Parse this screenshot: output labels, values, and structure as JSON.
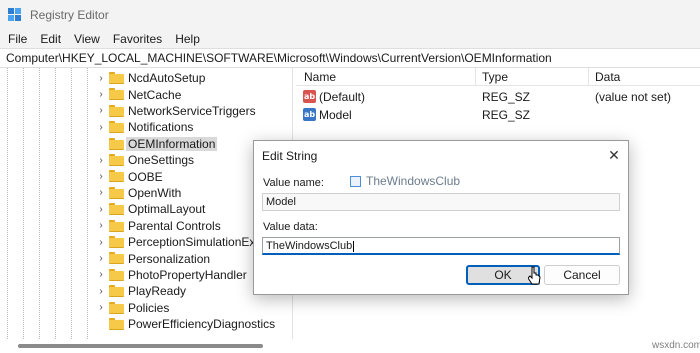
{
  "window": {
    "title": "Registry Editor",
    "app_icon": "registry-editor-icon"
  },
  "menu": [
    "File",
    "Edit",
    "View",
    "Favorites",
    "Help"
  ],
  "address": "Computer\\HKEY_LOCAL_MACHINE\\SOFTWARE\\Microsoft\\Windows\\CurrentVersion\\OEMInformation",
  "tree": {
    "items": [
      {
        "label": "NcdAutoSetup",
        "expander": "›"
      },
      {
        "label": "NetCache",
        "expander": "›"
      },
      {
        "label": "NetworkServiceTriggers",
        "expander": "›"
      },
      {
        "label": "Notifications",
        "expander": "›"
      },
      {
        "label": "OEMInformation",
        "expander": "",
        "selected": true
      },
      {
        "label": "OneSettings",
        "expander": "›"
      },
      {
        "label": "OOBE",
        "expander": "›"
      },
      {
        "label": "OpenWith",
        "expander": "›"
      },
      {
        "label": "OptimalLayout",
        "expander": "›"
      },
      {
        "label": "Parental Controls",
        "expander": "›"
      },
      {
        "label": "PerceptionSimulationExte",
        "expander": "›"
      },
      {
        "label": "Personalization",
        "expander": "›"
      },
      {
        "label": "PhotoPropertyHandler",
        "expander": "›"
      },
      {
        "label": "PlayReady",
        "expander": "›"
      },
      {
        "label": "Policies",
        "expander": "›"
      },
      {
        "label": "PowerEfficiencyDiagnostics",
        "expander": ""
      }
    ]
  },
  "list": {
    "columns": [
      "Name",
      "Type",
      "Data"
    ],
    "rows": [
      {
        "icon": "string-value-icon",
        "badge": "ab",
        "name": "(Default)",
        "type": "REG_SZ",
        "data": "(value not set)"
      },
      {
        "icon": "string-value-icon",
        "badge": "ab",
        "name": "Model",
        "type": "REG_SZ",
        "data": ""
      }
    ]
  },
  "dialog": {
    "title": "Edit String",
    "value_name_label": "Value name:",
    "value_name": "Model",
    "value_data_label": "Value data:",
    "value_data": "TheWindowsClub",
    "ok_label": "OK",
    "cancel_label": "Cancel",
    "close_glyph": "✕"
  },
  "watermark": "TheWindowsClub",
  "site_watermark": "wsxdn.com",
  "colors": {
    "accent": "#005fb8",
    "folder": "#f7c948",
    "selection": "#d9d9d9"
  }
}
